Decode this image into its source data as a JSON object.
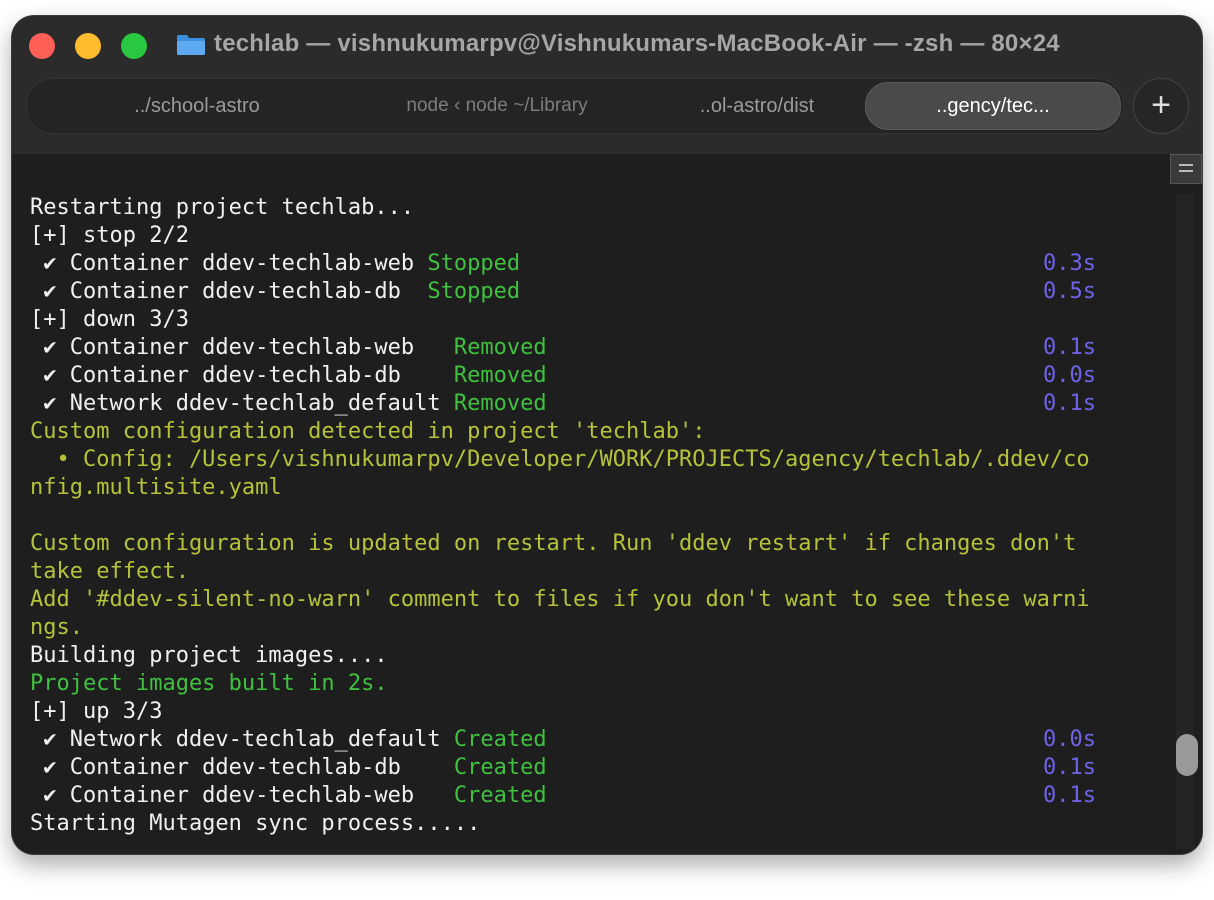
{
  "window": {
    "title": "techlab — vishnukumarpv@Vishnukumars-MacBook-Air — -zsh — 80×24"
  },
  "tabs": [
    {
      "label": "../school-astro",
      "active": false
    },
    {
      "label": "node ‹ node ~/Library",
      "active": false
    },
    {
      "label": "..ol-astro/dist",
      "active": false
    },
    {
      "label": "..gency/tec...",
      "active": true
    }
  ],
  "add_tab_label": "+",
  "terminal": {
    "lines": [
      "Restarting project techlab...",
      "[+] stop 2/2",
      " ✔ Container ddev-techlab-web ",
      "Stopped",
      "0.3s",
      " ✔ Container ddev-techlab-db  ",
      "Stopped",
      "0.5s",
      "[+] down 3/3",
      " ✔ Container ddev-techlab-web   ",
      "Removed",
      "0.1s",
      " ✔ Container ddev-techlab-db    ",
      "Removed",
      "0.0s",
      " ✔ Network ddev-techlab_default ",
      "Removed",
      "0.1s",
      "Custom configuration detected in project 'techlab':",
      "  • Config: /Users/vishnukumarpv/Developer/WORK/PROJECTS/agency/techlab/.ddev/co",
      "nfig.multisite.yaml",
      "Custom configuration is updated on restart. Run 'ddev restart' if changes don't",
      "take effect.",
      "Add '#ddev-silent-no-warn' comment to files if you don't want to see these warni",
      "ngs.",
      "Building project images....",
      "Project images built in 2s.",
      "[+] up 3/3",
      " ✔ Network ddev-techlab_default ",
      "Created",
      "0.0s",
      " ✔ Container ddev-techlab-db    ",
      "Created",
      "0.1s",
      " ✔ Container ddev-techlab-web   ",
      "Created",
      "0.1s",
      "Starting Mutagen sync process....."
    ]
  },
  "colors": {
    "success": "#3fc13f",
    "warning": "#b5c23a",
    "timing": "#6f63e8"
  }
}
